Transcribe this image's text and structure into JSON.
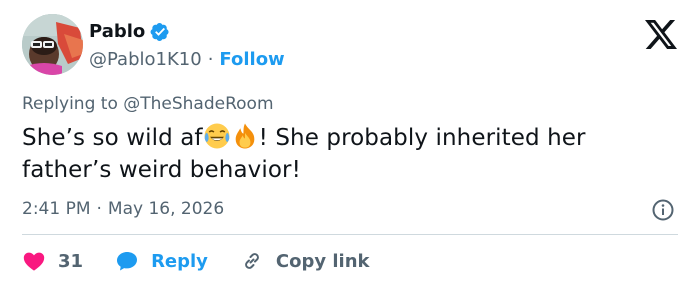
{
  "user": {
    "display_name": "Pablo",
    "handle": "@Pablo1K10",
    "separator": "·",
    "follow_label": "Follow"
  },
  "reply_context": {
    "prefix": "Replying to",
    "mention": "@TheShadeRoom"
  },
  "tweet": {
    "text_part1": "She’s so wild af",
    "emojis": [
      "face-with-tears-of-joy-emoji",
      "fire-emoji"
    ],
    "text_part2": "! She probably inherited her father’s weird behavior!"
  },
  "meta": {
    "time": "2:41 PM",
    "separator": "·",
    "date": "May 16, 2026"
  },
  "actions": {
    "like_count": "31",
    "reply_label": "Reply",
    "copy_label": "Copy link"
  },
  "colors": {
    "accent": "#1d9bf0",
    "like": "#f91880",
    "text": "#0f1419",
    "secondary": "#536471",
    "divider": "#cfd9de"
  },
  "icons": [
    "verified-badge-icon",
    "x-logo-icon",
    "info-icon",
    "heart-icon",
    "reply-bubble-icon",
    "link-icon"
  ]
}
